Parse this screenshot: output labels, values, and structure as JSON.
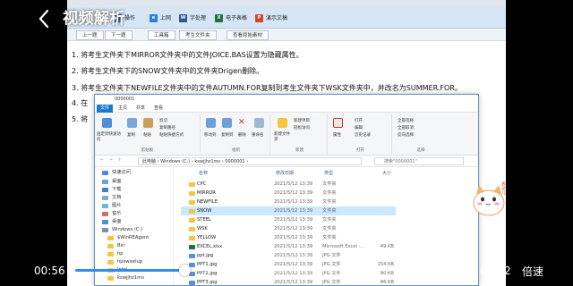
{
  "player": {
    "title": "视频解析",
    "time_current": "00:56",
    "time_total": "03:22",
    "speed_label": "倍速",
    "progress_fraction": 0.277,
    "accent": "#2f8cf6"
  },
  "app": {
    "menus": [
      {
        "label": "操作",
        "icon": "op-icon",
        "color": "#3b7bd6"
      },
      {
        "label": "上网",
        "icon": "ie-icon",
        "color": "#2a7fe0"
      },
      {
        "label": "字处理",
        "icon": "word-icon",
        "color": "#2b5797"
      },
      {
        "label": "电子表格",
        "icon": "excel-icon",
        "color": "#1e7145"
      },
      {
        "label": "演示文稿",
        "icon": "ppt-icon",
        "color": "#d24726"
      }
    ],
    "nav": {
      "prev": "上一题",
      "next": "下一题",
      "tool": "工具箱",
      "folder": "考生文件夹",
      "material": "查看原始素材"
    }
  },
  "questions": [
    "1. 将考生文件夹下MIRROR文件夹中的文件JOICE.BAS设置为隐藏属性。",
    "2. 将考生文件夹下的SNOW文件夹中的文件夹Drigen删除。",
    "3. 将考生文件夹下NEWFILE文件夹中的文件AUTUMN.FOR复制到考生文件夹下WSK文件夹中，并改名为SUMMER.FOR。",
    "4. 在",
    "5. 将"
  ],
  "explorer": {
    "window_title": "0000001",
    "tabs": [
      "文件",
      "主页",
      "共享",
      "查看"
    ],
    "ribbon": {
      "pin": "固定到快速访问",
      "copy": "复制",
      "paste": "粘贴",
      "cut": "剪切",
      "copy_path": "复制路径",
      "paste_shortcut": "粘贴快捷方式",
      "clipboard": "剪贴板",
      "move_to": "移动到",
      "copy_to": "复制到",
      "delete": "删除",
      "rename": "重命名",
      "organize": "组织",
      "new_item": "新建项目",
      "easy_access": "轻松访问",
      "new_folder": "新建文件夹",
      "new": "新建",
      "properties": "属性",
      "open": "打开",
      "edit": "编辑",
      "history": "历史记录",
      "open_group": "打开",
      "select_all": "全部选择",
      "select_none": "全部取消",
      "invert": "反向选择",
      "select": "选择"
    },
    "address": "此电脑 › Windows (C:) › kswjjhz1ms › 0000001 ›",
    "search_placeholder": "搜索\"0000001\"",
    "columns": {
      "name": "名称",
      "date": "修改日期",
      "type": "类型",
      "size": "大小"
    },
    "tree": [
      "快速访问",
      "桌面",
      "下载",
      "文档",
      "图片",
      "音乐",
      "桌面",
      "Windows (C:)",
      "$WinREAgent",
      "Bin",
      "hp",
      "hpswsetup",
      "Intel",
      "kswjjhz1ms"
    ],
    "files": [
      {
        "name": "CPC",
        "date": "2021/5/12 13:39",
        "type": "文件夹",
        "size": "",
        "kind": "folder"
      },
      {
        "name": "MIRROR",
        "date": "2021/5/12 13:39",
        "type": "文件夹",
        "size": "",
        "kind": "folder"
      },
      {
        "name": "NEWFILE",
        "date": "2021/5/12 13:39",
        "type": "文件夹",
        "size": "",
        "kind": "folder"
      },
      {
        "name": "SNOW",
        "date": "2021/5/12 13:39",
        "type": "文件夹",
        "size": "",
        "kind": "folder",
        "selected": true
      },
      {
        "name": "STEEL",
        "date": "2021/5/12 13:39",
        "type": "文件夹",
        "size": "",
        "kind": "folder"
      },
      {
        "name": "WSK",
        "date": "2021/5/12 13:39",
        "type": "文件夹",
        "size": "",
        "kind": "folder"
      },
      {
        "name": "YELLOW",
        "date": "2021/5/12 13:39",
        "type": "文件夹",
        "size": "",
        "kind": "folder"
      },
      {
        "name": "EXCEL.xlsx",
        "date": "2021/5/12 13:39",
        "type": "Microsoft Excel ...",
        "size": "49 KB",
        "kind": "doc"
      },
      {
        "name": "ppt.jpg",
        "date": "2021/5/12 13:39",
        "type": "JPG 文件",
        "size": "",
        "kind": "img"
      },
      {
        "name": "PPT1.jpg",
        "date": "2021/5/12 13:39",
        "type": "JPG 文件",
        "size": "154 KB",
        "kind": "img"
      },
      {
        "name": "PPT2.jpg",
        "date": "2021/5/12 13:39",
        "type": "JPG 文件",
        "size": "80 KB",
        "kind": "img"
      },
      {
        "name": "PPT3.jpg",
        "date": "2021/5/12 13:39",
        "type": "JPG 文件",
        "size": "86 KB",
        "kind": "img"
      }
    ]
  },
  "mascot": {
    "caption": "表达儿"
  }
}
